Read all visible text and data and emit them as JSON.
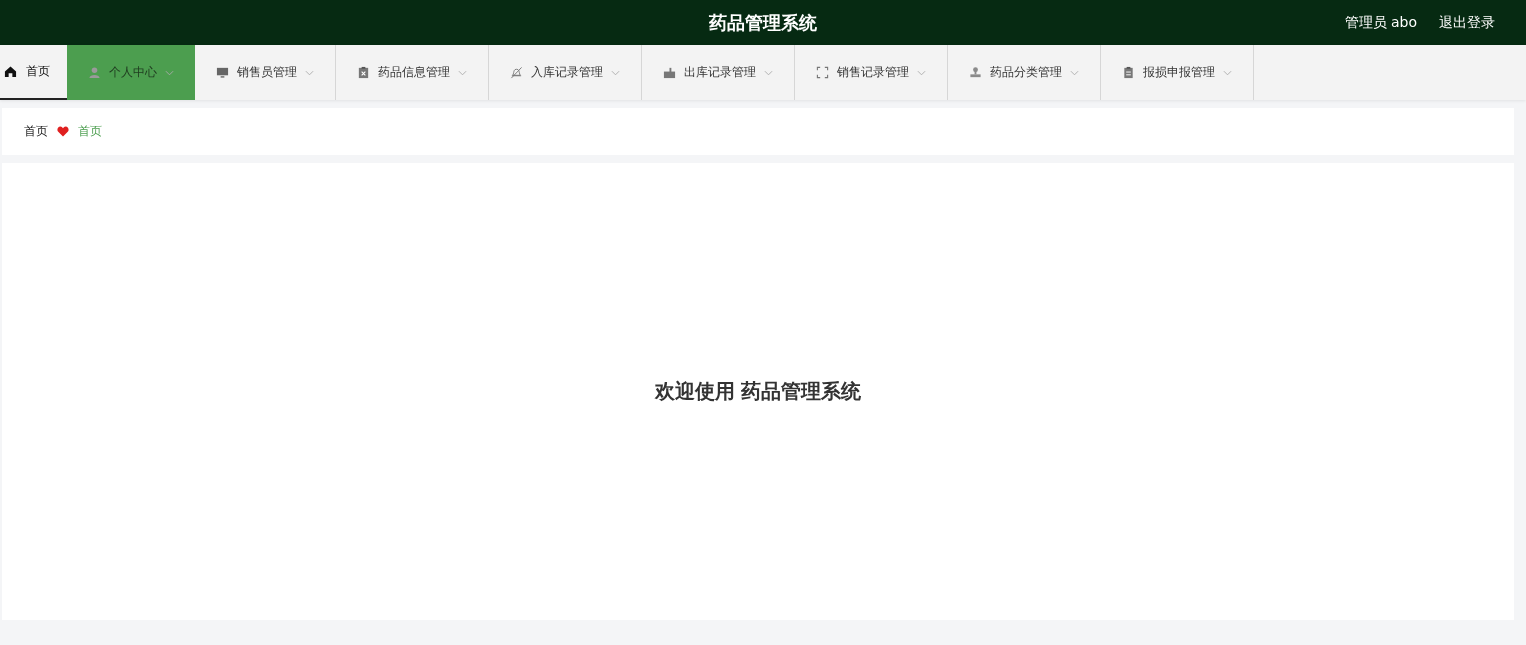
{
  "header": {
    "title": "药品管理系统",
    "user": "管理员 abo",
    "logout": "退出登录"
  },
  "menu": [
    {
      "label": "首页",
      "kind": "home",
      "selected": true,
      "highlighted": false,
      "dropdown": false
    },
    {
      "label": "个人中心",
      "kind": "person",
      "selected": false,
      "highlighted": true,
      "dropdown": true
    },
    {
      "label": "销售员管理",
      "kind": "monitor",
      "selected": false,
      "highlighted": false,
      "dropdown": true
    },
    {
      "label": "药品信息管理",
      "kind": "medicine",
      "selected": false,
      "highlighted": false,
      "dropdown": true
    },
    {
      "label": "入库记录管理",
      "kind": "inbound",
      "selected": false,
      "highlighted": false,
      "dropdown": true
    },
    {
      "label": "出库记录管理",
      "kind": "outbound",
      "selected": false,
      "highlighted": false,
      "dropdown": true
    },
    {
      "label": "销售记录管理",
      "kind": "sales",
      "selected": false,
      "highlighted": false,
      "dropdown": true
    },
    {
      "label": "药品分类管理",
      "kind": "category",
      "selected": false,
      "highlighted": false,
      "dropdown": true
    },
    {
      "label": "报损申报管理",
      "kind": "report",
      "selected": false,
      "highlighted": false,
      "dropdown": true
    }
  ],
  "breadcrumb": [
    "首页",
    "首页"
  ],
  "welcome": "欢迎使用 药品管理系统"
}
